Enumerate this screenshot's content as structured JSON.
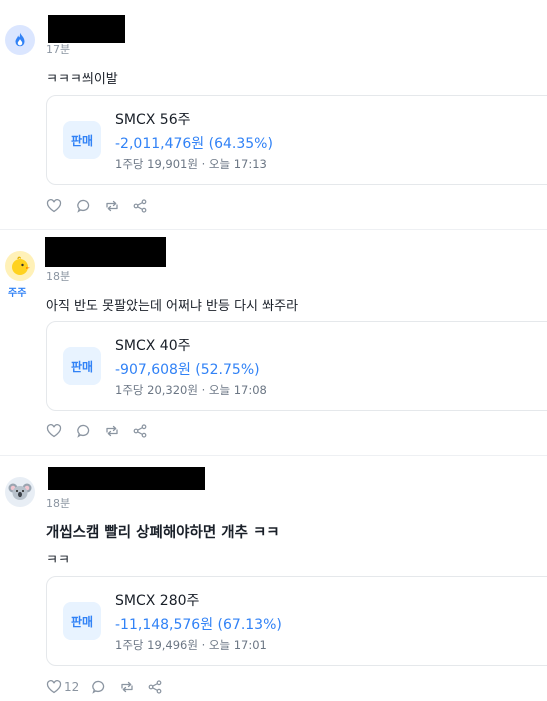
{
  "posts": [
    {
      "time": "17분",
      "body": "ㅋㅋㅋ씌이발",
      "card": {
        "tag": "판매",
        "name": "SMCX 56주",
        "profit": "-2,011,476원 (64.35%)",
        "meta": "1주당 19,901원 · 오늘 17:13"
      },
      "likes": ""
    },
    {
      "badge": "주주",
      "time": "18분",
      "body": "아직 반도 못팔았는데 어쩌냐 반등 다시 쏴주라",
      "card": {
        "tag": "판매",
        "name": "SMCX 40주",
        "profit": "-907,608원 (52.75%)",
        "meta": "1주당 20,320원 · 오늘 17:08"
      },
      "likes": ""
    },
    {
      "time": "18분",
      "title": "개씹스캠 빨리 상폐해야하면 개추 ㅋㅋ",
      "body": "ㅋㅋ",
      "card": {
        "tag": "판매",
        "name": "SMCX 280주",
        "profit": "-11,148,576원 (67.13%)",
        "meta": "1주당 19,496원 · 오늘 17:01"
      },
      "likes": "12"
    }
  ],
  "icons": {
    "like": "heart-icon",
    "comment": "comment-icon",
    "repost": "repost-icon",
    "share": "share-icon"
  },
  "colors": {
    "accent": "#3182f6",
    "muted": "#8b95a1",
    "tag_bg": "#e8f3ff"
  }
}
